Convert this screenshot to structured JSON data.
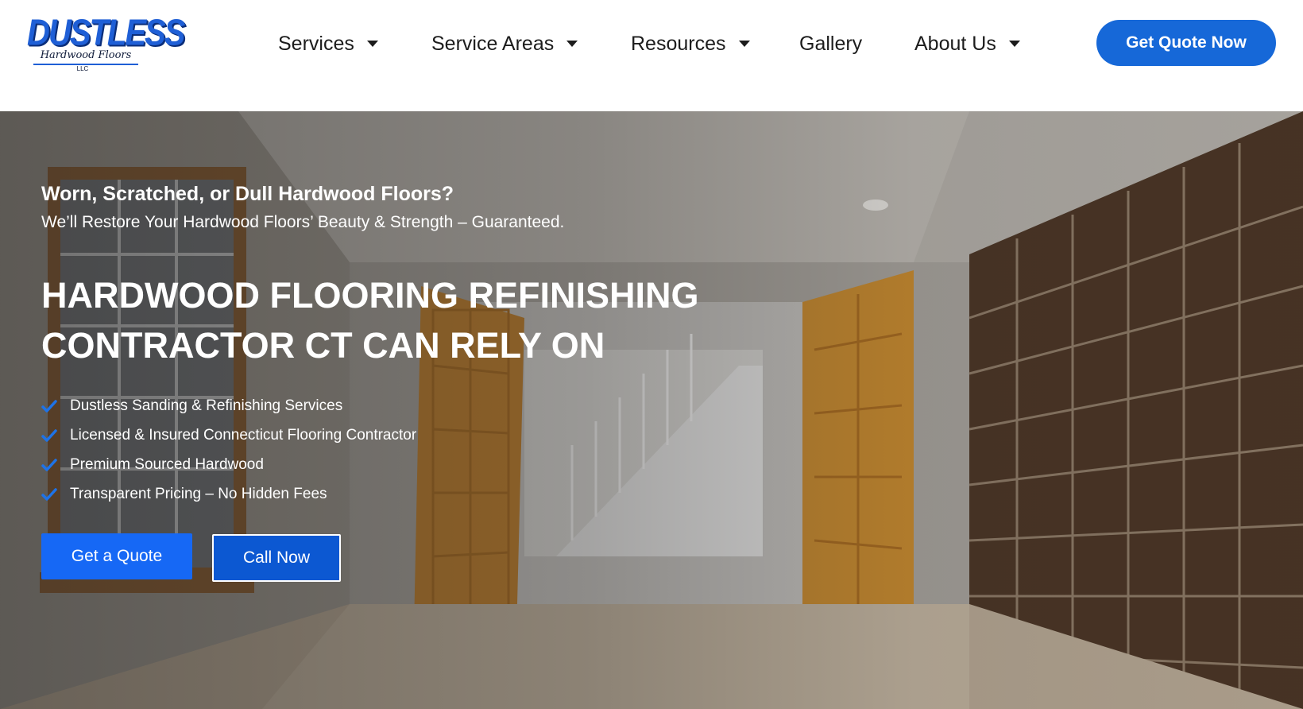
{
  "logo": {
    "word": "DUSTLESS",
    "script": "Hardwood Floors",
    "llc": "LLC"
  },
  "nav": {
    "items": [
      {
        "label": "Services",
        "dropdown": true
      },
      {
        "label": "Service Areas",
        "dropdown": true
      },
      {
        "label": "Resources",
        "dropdown": true
      },
      {
        "label": "Gallery",
        "dropdown": false
      },
      {
        "label": "About Us",
        "dropdown": true
      }
    ],
    "cta_label": "Get Quote Now"
  },
  "hero": {
    "kicker": "Worn, Scratched, or Dull Hardwood Floors?",
    "subtitle": "We’ll Restore Your Hardwood Floors’ Beauty & Strength – Guaranteed.",
    "title_line1": "HARDWOOD FLOORING REFINISHING",
    "title_line2": "CONTRACTOR CT CAN RELY ON",
    "features": [
      "Dustless Sanding & Refinishing Services",
      "Licensed & Insured Connecticut Flooring Contractor",
      "Premium Sourced Hardwood",
      "Transparent Pricing – No Hidden Fees"
    ],
    "primary_button": "Get a Quote",
    "secondary_button": "Call Now"
  },
  "colors": {
    "brand_blue": "#1668d8",
    "button_blue": "#1668f5",
    "check_blue": "#1e73e8",
    "nav_text": "#1c1c1c"
  },
  "icons": {
    "feature_bullet": "check-icon",
    "nav_dropdown": "caret-down-icon"
  }
}
